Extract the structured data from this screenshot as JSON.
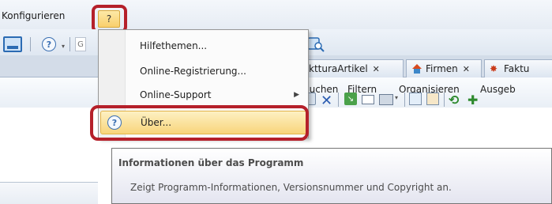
{
  "menubar": {
    "konfigurieren_label": "Konfigurieren",
    "help_menu_label": "?"
  },
  "toolbar": {
    "help_icon_label": "?",
    "dropdown_glyph": "▾",
    "cut_text": "G"
  },
  "tabs": [
    {
      "label": "ktturaArtikel",
      "close": "✕"
    },
    {
      "label": "Firmen",
      "close": "✕",
      "icon": "house-icon"
    },
    {
      "label": "Faktu",
      "icon": "faktu-icon"
    }
  ],
  "command_menu": {
    "suchen": "Suchen",
    "filtern": "Filtern",
    "organisieren": "Organisieren",
    "ausgeben": "Ausgeb"
  },
  "help_menu": {
    "items": [
      {
        "label": "Hilfethemen..."
      },
      {
        "label": "Online-Registrierung..."
      },
      {
        "label": "Online-Support",
        "submenu_arrow": "▶"
      },
      {
        "label": "Über...",
        "icon_label": "?"
      }
    ]
  },
  "tooltip": {
    "title": "Informationen über das Programm",
    "body": "Zeigt Programm-Informationen, Versionsnummer und Copyright an."
  },
  "colors": {
    "highlight_frame": "#b5202a",
    "hover_item": "#f8d57b",
    "accent_blue": "#3a6fb2"
  }
}
